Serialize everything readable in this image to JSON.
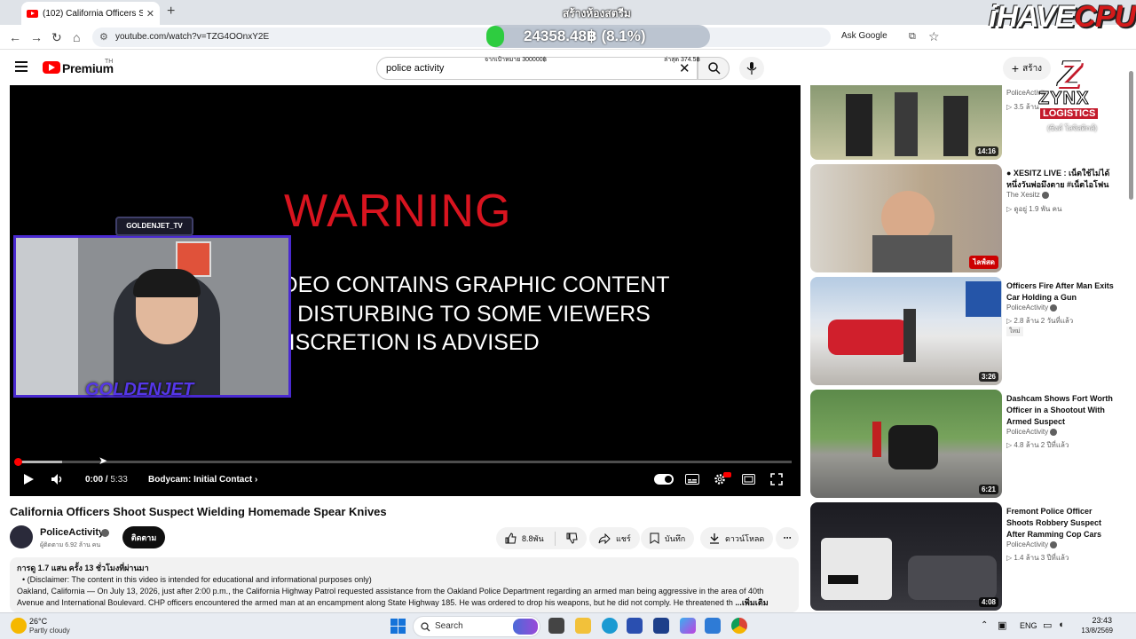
{
  "browser": {
    "tab_title": "(102) California Officers Shoot S",
    "tab_close": "✕",
    "new_tab": "+",
    "url": "youtube.com/watch?v=TZG4OOnxY2E",
    "ask_google": "Ask Google"
  },
  "youtube": {
    "brand": "Premium",
    "region": "TH",
    "search_query": "police activity",
    "create_label": "สร้าง"
  },
  "overlay": {
    "title": "สร้างห้องสตรีม",
    "amount": "24358.48฿ (8.1%)",
    "goal": "จากเป้าหมาย 300000฿",
    "last": "ล่าสุด 374.5฿",
    "ihave": "iHAVE",
    "cpu": "CPU",
    "facecam_top": "GOLDENJET_TV",
    "facecam_name": "GOLDENJET",
    "sponsor_letter": "Z",
    "sponsor_name": "ZYNX",
    "sponsor_tag": "LOGISTICS",
    "sponsor_th": "(ซิงค์ โลจิสติกส์)"
  },
  "player": {
    "warning": "WARNING",
    "line1": "THIS VIDEO CONTAINS GRAPHIC CONTENT",
    "line2": "MAY BE DISTURBING TO SOME VIEWERS",
    "line3": "VIEWER DISCRETION IS ADVISED",
    "time_current": "0:00",
    "time_total": "5:33",
    "chapter": "Bodycam: Initial Contact ›",
    "progress": 0.0
  },
  "video": {
    "title": "California Officers Shoot Suspect Wielding Homemade Spear Knives",
    "channel": "PoliceActivity",
    "subscribers": "ผู้ติดตาม 6.92 ล้าน คน",
    "subscribe": "ติดตาม",
    "likes": "8.8พัน",
    "share": "แชร์",
    "save": "บันทึก",
    "download": "ดาวน์โหลด",
    "desc_meta": "การดู 1.7 แสน ครั้ง  13 ชั่วโมงที่ผ่านมา",
    "desc_line1": "•  (Disclaimer: The content in this video is intended for educational and informational purposes only)",
    "desc_line2": "Oakland, California — On July 13, 2026, just after 2:00 p.m., the California Highway Patrol requested assistance from the Oakland Police Department regarding an armed man being aggressive in the area of 40th",
    "desc_line3": "Avenue and International Boulevard. CHP officers encountered the armed man at an encampment along State Highway 185. He was ordered to drop his weapons, but he did not comply. He threatened th",
    "desc_more": "...เพิ่มเติม"
  },
  "sidebar": [
    {
      "title": "",
      "channel": "PoliceActivity",
      "meta": "▷ 3.5 ล้าน",
      "badge": "14:16",
      "new": ""
    },
    {
      "title": "● XESITZ LIVE : เน็ตใช้ไม่ได้ หนึ่งวันพ่อมึงตาย #เน็ตไอโฟน",
      "channel": "The Xesitz",
      "meta": "▷ ดูอยู่ 1.9 พัน คน",
      "badge": "ไลฟ์สด",
      "new": ""
    },
    {
      "title": "Officers Fire After Man Exits Car Holding a Gun",
      "channel": "PoliceActivity",
      "meta": "▷ 2.8 ล้าน  2 วันที่แล้ว",
      "badge": "3:26",
      "new": "ใหม่"
    },
    {
      "title": "Dashcam Shows Fort Worth Officer in a Shootout With Armed Suspect",
      "channel": "PoliceActivity",
      "meta": "▷ 4.8 ล้าน  2 ปีที่แล้ว",
      "badge": "6:21",
      "new": ""
    },
    {
      "title": "Fremont Police Officer Shoots Robbery Suspect After Ramming Cop Cars",
      "channel": "PoliceActivity",
      "meta": "▷ 1.4 ล้าน  3 ปีที่แล้ว",
      "badge": "4:08",
      "new": ""
    }
  ],
  "taskbar": {
    "temp": "26°C",
    "weather": "Partly cloudy",
    "search": "Search",
    "lang": "ENG",
    "time": "23:43",
    "date": "13/8/2569"
  }
}
